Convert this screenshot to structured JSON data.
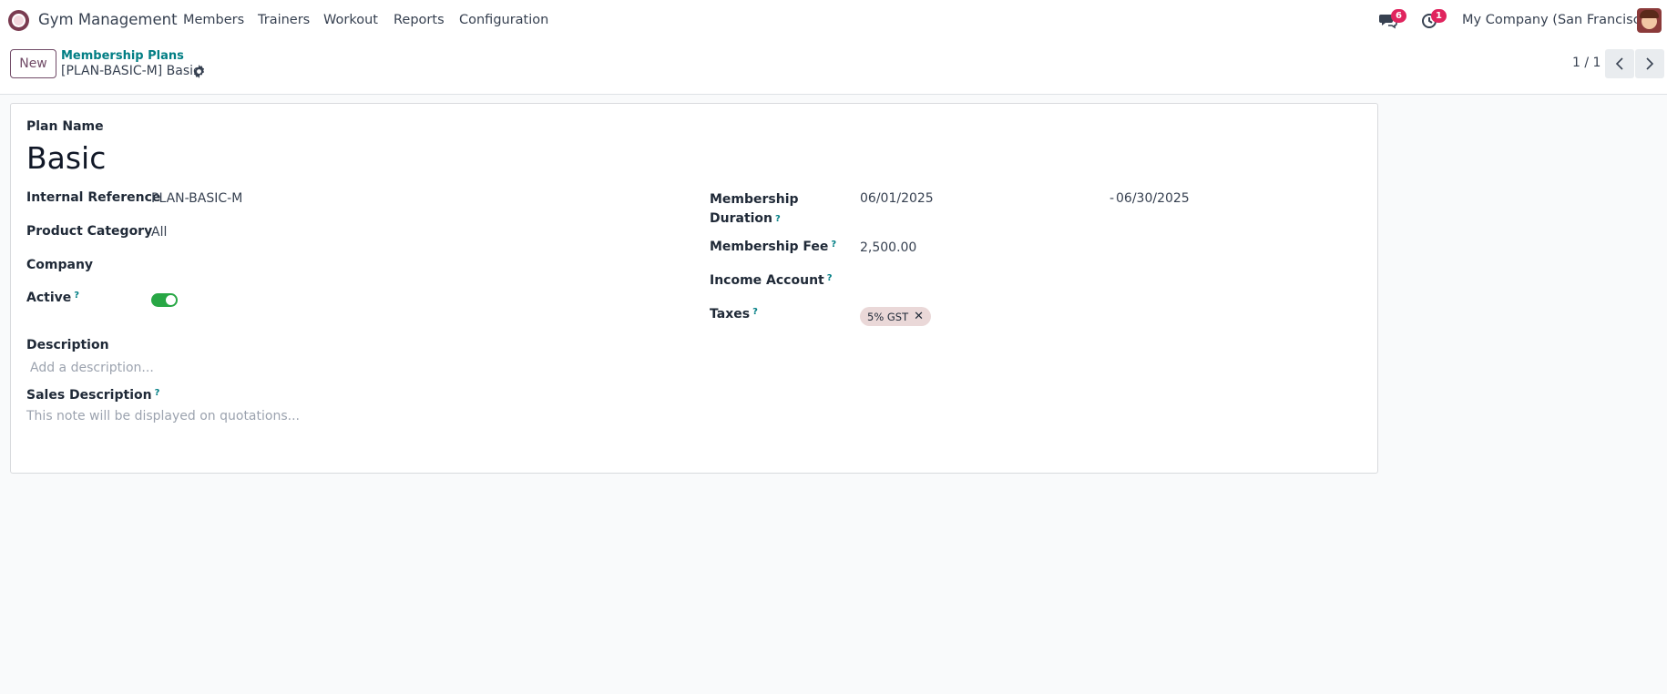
{
  "app": {
    "name": "Gym Management"
  },
  "nav": {
    "items": [
      {
        "label": "Members"
      },
      {
        "label": "Trainers"
      },
      {
        "label": "Workout"
      },
      {
        "label": "Reports"
      },
      {
        "label": "Configuration"
      }
    ],
    "messages_count": "6",
    "activities_count": "1",
    "company": "My Company (San Francisco)"
  },
  "control": {
    "new_label": "New",
    "breadcrumb_parent": "Membership Plans",
    "breadcrumb_current": "[PLAN-BASIC-M] Basic",
    "pager": "1 / 1"
  },
  "form": {
    "plan_name_label": "Plan Name",
    "plan_name": "Basic",
    "internal_reference_label": "Internal Reference",
    "internal_reference": "PLAN-BASIC-M",
    "product_category_label": "Product Category",
    "product_category": "All",
    "company_label": "Company",
    "company": "",
    "active_label": "Active",
    "active": true,
    "description_label": "Description",
    "description_placeholder": "Add a description...",
    "sales_description_label": "Sales Description",
    "sales_description_placeholder": "This note will be displayed on quotations...",
    "membership_duration_label_1": "Membership",
    "membership_duration_label_2": "Duration",
    "duration_start": "06/01/2025",
    "duration_end": "06/30/2025",
    "duration_separator": "-",
    "membership_fee_label": "Membership Fee",
    "membership_fee": "2,500.00",
    "income_account_label": "Income Account",
    "income_account": "",
    "taxes_label": "Taxes",
    "taxes": [
      "5% GST"
    ],
    "help_mark": "?"
  },
  "colors": {
    "brand": "#714b67",
    "link": "#017e84",
    "toggle_on": "#28a745",
    "badge": "#e0245e"
  }
}
